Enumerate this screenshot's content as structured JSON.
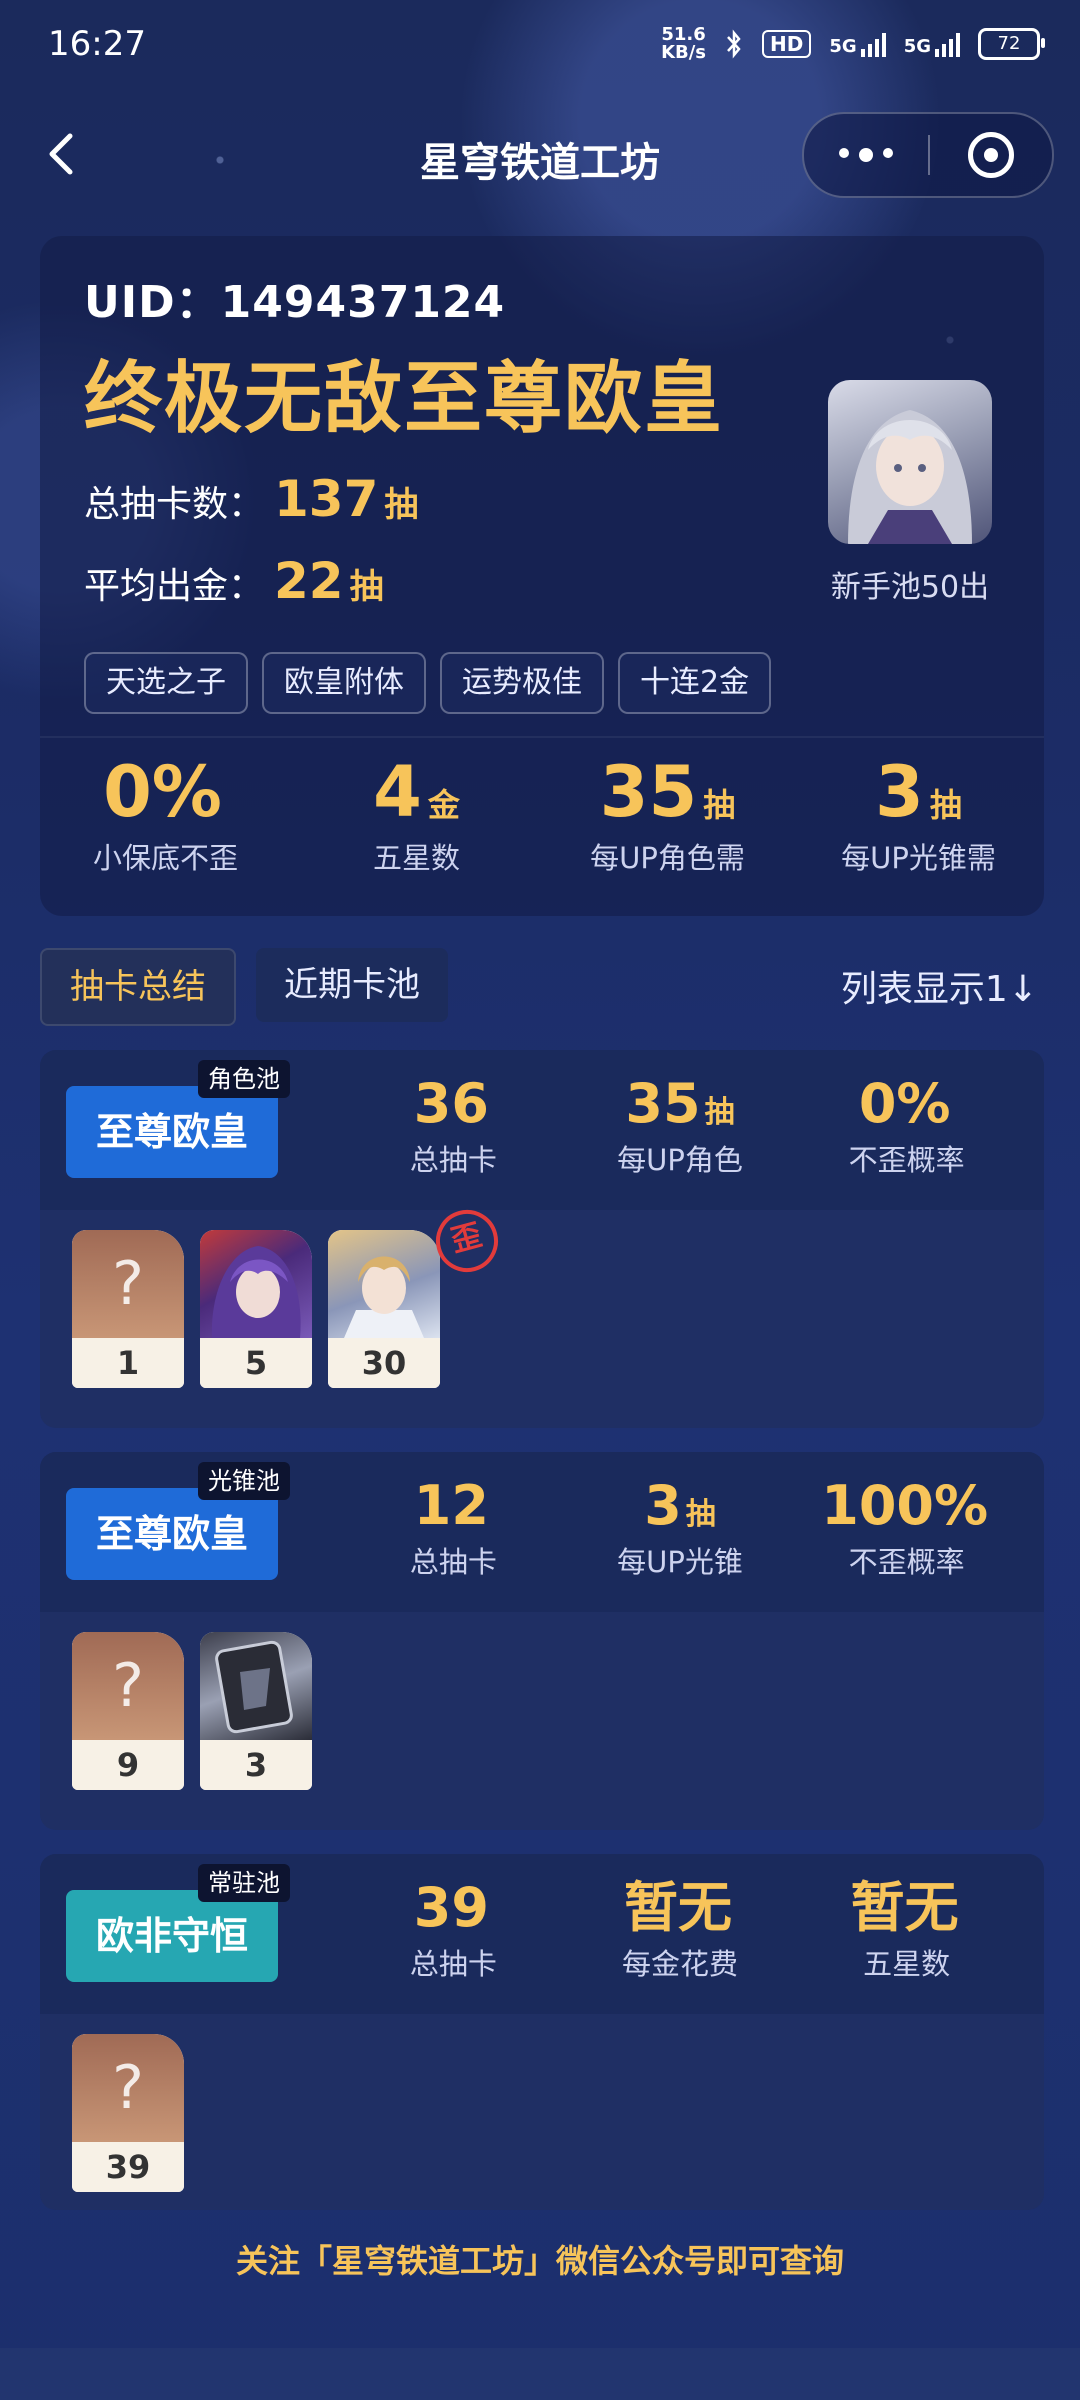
{
  "status_bar": {
    "time": "16:27",
    "net_speed_top": "51.6",
    "net_speed_bottom": "KB/s",
    "hd": "HD",
    "sig1": "5G",
    "sig2": "5G",
    "battery": "72"
  },
  "nav": {
    "title": "星穹铁道工坊"
  },
  "hero": {
    "uid": "UID：149437124",
    "rank": "终极无敌至尊欧皇",
    "total_label": "总抽卡数：",
    "total_value": "137",
    "total_unit": "抽",
    "avg_label": "平均出金：",
    "avg_value": "22",
    "avg_unit": "抽",
    "avatar_caption": "新手池50出",
    "tags": [
      "天选之子",
      "欧皇附体",
      "运势极佳",
      "十连2金"
    ]
  },
  "kpis": [
    {
      "value": "0%",
      "unit": "",
      "label": "小保底不歪"
    },
    {
      "value": "4",
      "unit": "金",
      "label": "五星数"
    },
    {
      "value": "35",
      "unit": "抽",
      "label": "每UP角色需"
    },
    {
      "value": "3",
      "unit": "抽",
      "label": "每UP光锥需"
    }
  ],
  "tabs": {
    "summary": "抽卡总结",
    "recent": "近期卡池",
    "list_toggle": "列表显示1↓"
  },
  "pools": [
    {
      "badge": "至尊欧皇",
      "tag": "角色池",
      "metrics": [
        {
          "value": "36",
          "unit": "",
          "label": "总抽卡"
        },
        {
          "value": "35",
          "unit": "抽",
          "label": "每UP角色"
        },
        {
          "value": "0%",
          "unit": "",
          "label": "不歪概率"
        }
      ],
      "cards": [
        {
          "glyph": "?",
          "count": "1"
        },
        {
          "glyph": "",
          "count": "5"
        },
        {
          "glyph": "",
          "count": "30"
        }
      ],
      "stamp": "歪"
    },
    {
      "badge": "至尊欧皇",
      "tag": "光锥池",
      "metrics": [
        {
          "value": "12",
          "unit": "",
          "label": "总抽卡"
        },
        {
          "value": "3",
          "unit": "抽",
          "label": "每UP光锥"
        },
        {
          "value": "100%",
          "unit": "",
          "label": "不歪概率"
        }
      ],
      "cards": [
        {
          "glyph": "?",
          "count": "9"
        },
        {
          "glyph": "",
          "count": "3"
        }
      ]
    },
    {
      "badge": "欧非守恒",
      "tag": "常驻池",
      "metrics": [
        {
          "value": "39",
          "unit": "",
          "label": "总抽卡"
        },
        {
          "value": "暂无",
          "unit": "",
          "label": "每金花费"
        },
        {
          "value": "暂无",
          "unit": "",
          "label": "五星数"
        }
      ],
      "cards": [
        {
          "glyph": "?",
          "count": "39"
        }
      ]
    }
  ],
  "footer": "关注「星穹铁道工坊」微信公众号即可查询",
  "colors": {
    "gold": "#f7c45a",
    "blue_badge": "#1f6bd8",
    "teal_badge": "#26a7b2"
  }
}
